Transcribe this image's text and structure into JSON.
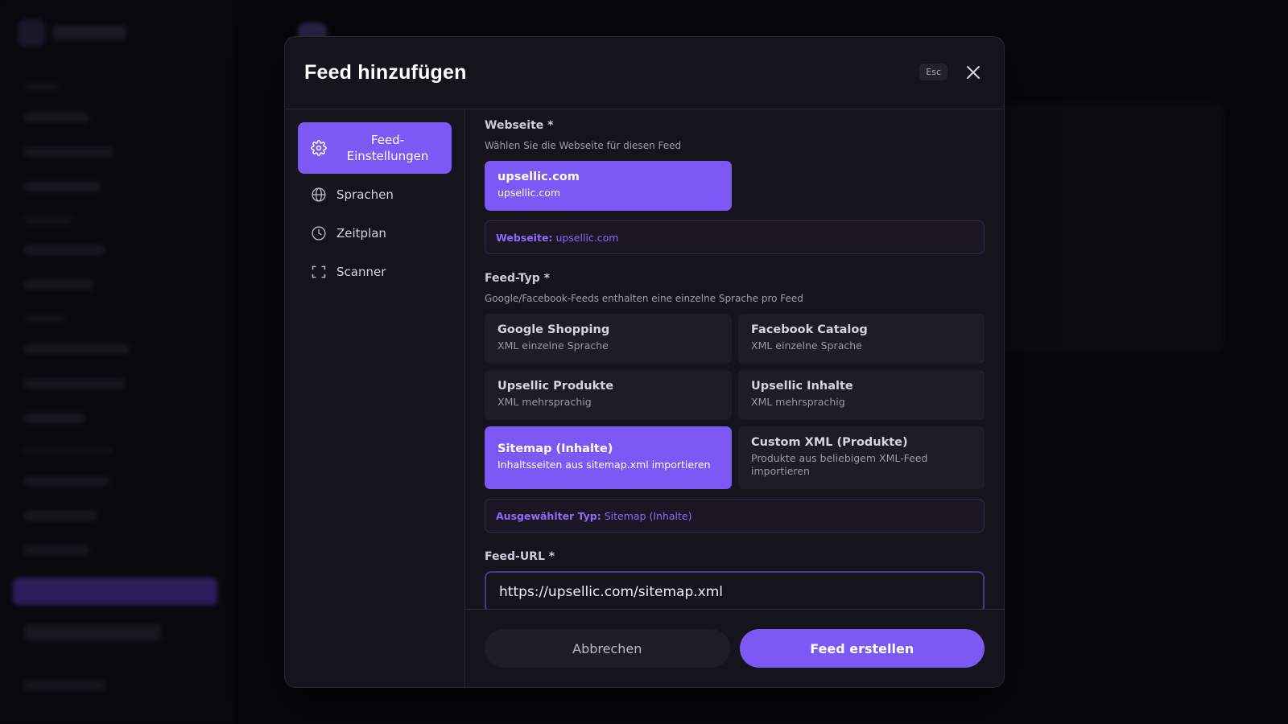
{
  "modal": {
    "title": "Feed hinzufügen",
    "esc_label": "Esc"
  },
  "nav": {
    "items": [
      {
        "label": "Feed-Einstellungen",
        "icon": "gear-icon",
        "active": true
      },
      {
        "label": "Sprachen",
        "icon": "globe-icon",
        "active": false
      },
      {
        "label": "Zeitplan",
        "icon": "clock-icon",
        "active": false
      },
      {
        "label": "Scanner",
        "icon": "scan-frame-icon",
        "active": false
      }
    ]
  },
  "website": {
    "label": "Webseite *",
    "help": "Wählen Sie die Webseite für diesen Feed",
    "option": {
      "title": "upsellic.com",
      "subtitle": "upsellic.com"
    },
    "info_label": "Webseite:",
    "info_value": "upsellic.com"
  },
  "feed_type": {
    "label": "Feed-Typ *",
    "help": "Google/Facebook-Feeds enthalten eine einzelne Sprache pro Feed",
    "options": [
      {
        "title": "Google Shopping",
        "subtitle": "XML einzelne Sprache",
        "selected": false
      },
      {
        "title": "Facebook Catalog",
        "subtitle": "XML einzelne Sprache",
        "selected": false
      },
      {
        "title": "Upsellic Produkte",
        "subtitle": "XML mehrsprachig",
        "selected": false
      },
      {
        "title": "Upsellic Inhalte",
        "subtitle": "XML mehrsprachig",
        "selected": false
      },
      {
        "title": "Sitemap (Inhalte)",
        "subtitle": "Inhaltsseiten aus sitemap.xml importieren",
        "selected": true
      },
      {
        "title": "Custom XML (Produkte)",
        "subtitle": "Produkte aus beliebigem XML-Feed importieren",
        "selected": false
      }
    ],
    "info_label": "Ausgewählter Typ:",
    "info_value": "Sitemap (Inhalte)"
  },
  "feed_url": {
    "label": "Feed-URL *",
    "value": "https://upsellic.com/sitemap.xml"
  },
  "footer": {
    "cancel_label": "Abbrechen",
    "submit_label": "Feed erstellen"
  },
  "colors": {
    "accent": "#7c58f5",
    "modal_bg": "#15131c",
    "option_bg": "#1e1c26"
  }
}
